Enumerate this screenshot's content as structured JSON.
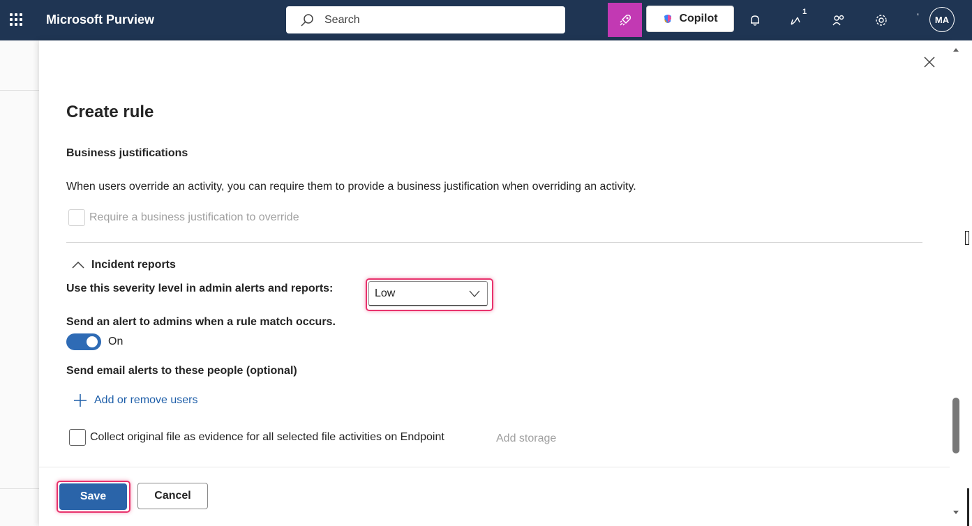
{
  "header": {
    "app_title": "Microsoft Purview",
    "search_placeholder": "Search",
    "copilot_label": "Copilot",
    "notification_badge": "1",
    "avatar_initials": "MA"
  },
  "panel": {
    "title": "Create rule",
    "business_justifications": {
      "heading": "Business justifications",
      "description": "When users override an activity, you can require them to provide a business justification when overriding an activity.",
      "checkbox_label": "Require a business justification to override"
    },
    "incident_reports": {
      "heading": "Incident reports",
      "severity_label": "Use this severity level in admin alerts and reports:",
      "severity_value": "Low",
      "alert_label": "Send an alert to admins when a rule match occurs.",
      "toggle_label": "On",
      "email_label": "Send email alerts to these people (optional)",
      "add_users_label": "Add or remove users",
      "evidence_checkbox_label": "Collect original file as evidence for all selected file activities on Endpoint",
      "add_storage_label": "Add storage"
    },
    "footer": {
      "save_label": "Save",
      "cancel_label": "Cancel"
    }
  },
  "colors": {
    "header_bg": "#1f3553",
    "accent_blue": "#2a64a9",
    "highlight": "#e8336d",
    "brand_pink": "#c239b3"
  }
}
